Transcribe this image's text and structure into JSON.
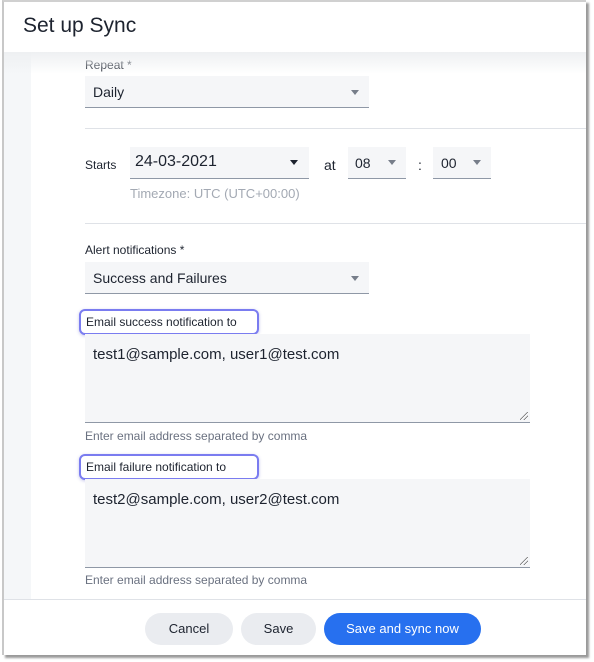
{
  "dialog": {
    "title": "Set up Sync"
  },
  "repeat": {
    "label": "Repeat *",
    "value": "Daily"
  },
  "starts": {
    "label": "Starts",
    "date": "24-03-2021",
    "at_label": "at",
    "hour": "08",
    "separator": ":",
    "minute": "00",
    "timezone": "Timezone: UTC (UTC+00:00)"
  },
  "alerts": {
    "label": "Alert notifications *",
    "value": "Success and Failures"
  },
  "success_email": {
    "label": "Email success notification to",
    "value": "test1@sample.com, user1@test.com",
    "hint": "Enter email address separated by comma"
  },
  "failure_email": {
    "label": "Email failure notification to",
    "value": "test2@sample.com, user2@test.com",
    "hint": "Enter email address separated by comma"
  },
  "footer": {
    "cancel_label": "Cancel",
    "save_label": "Save",
    "save_sync_label": "Save and sync now"
  },
  "colors": {
    "primary": "#2770ef",
    "highlight": "#7a7cf0",
    "field_bg": "#f5f6f8"
  }
}
